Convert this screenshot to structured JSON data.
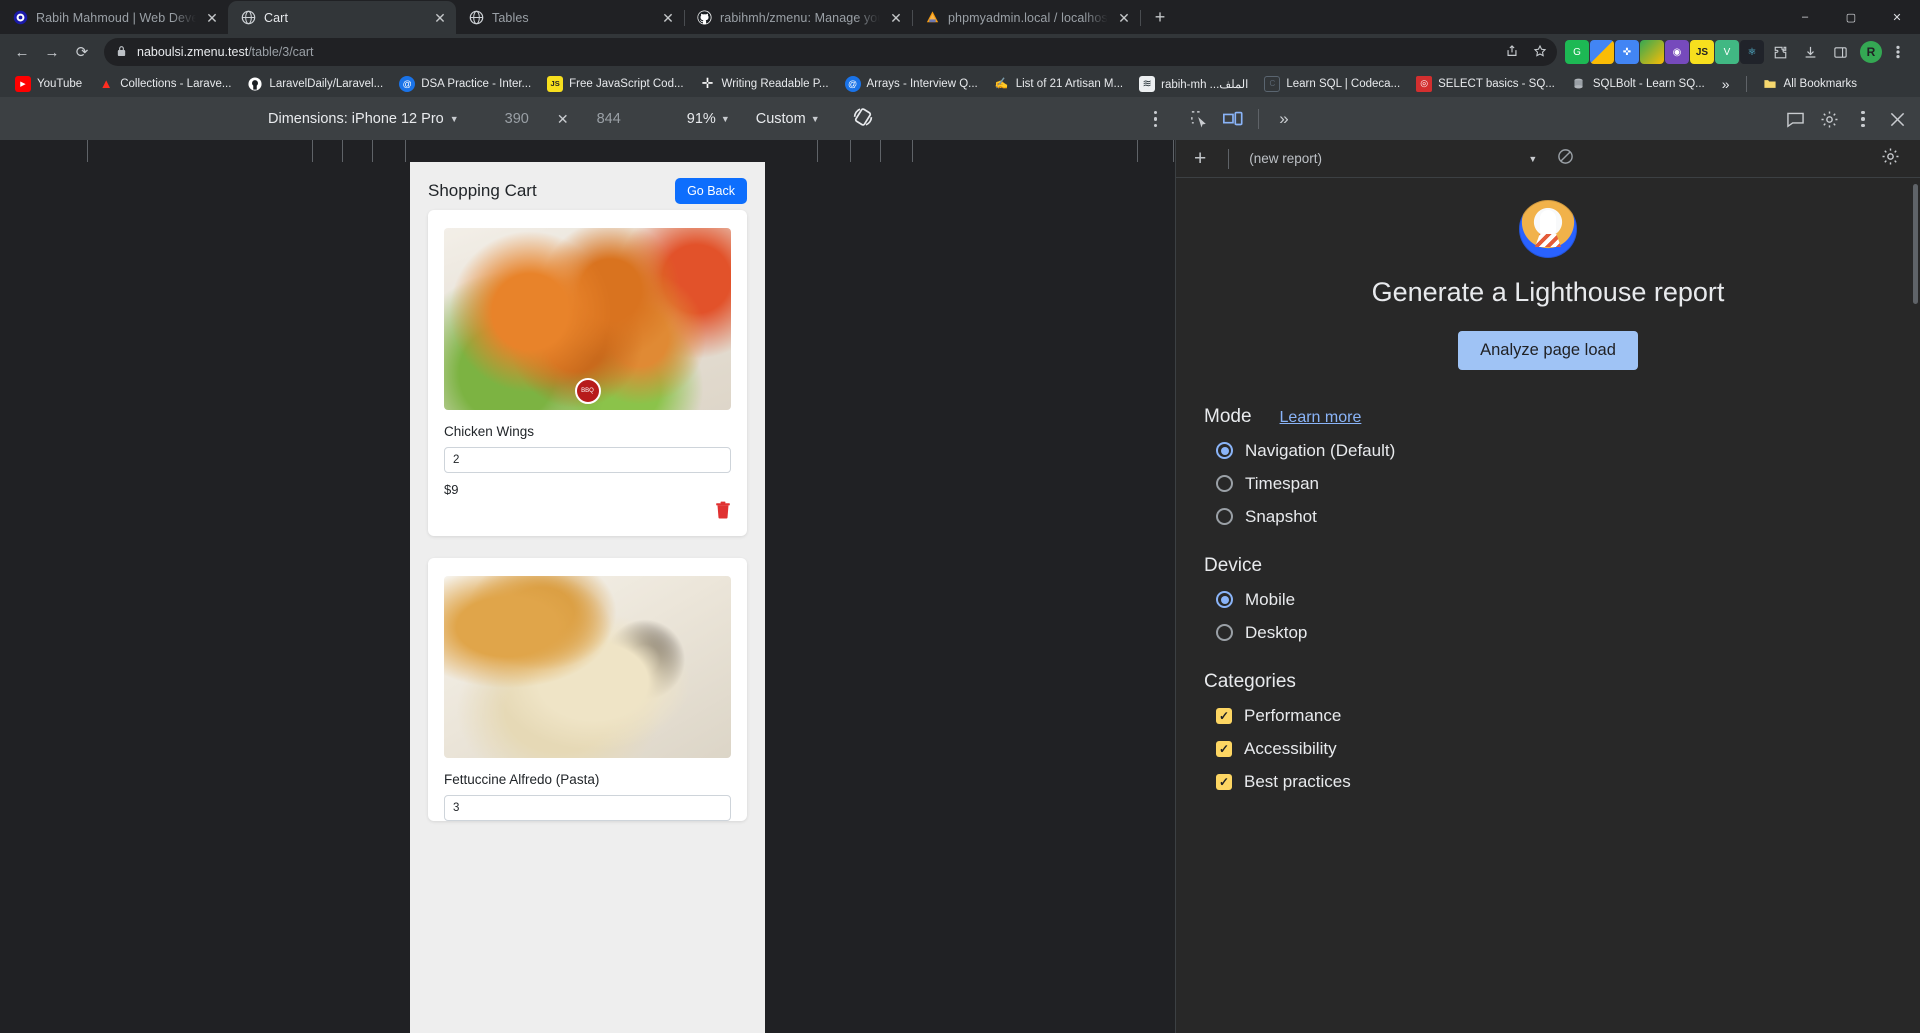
{
  "window": {
    "minimize": "–",
    "maximize": "▢",
    "close": "✕"
  },
  "tabs": [
    {
      "title": "Rabih Mahmoud | Web Develop",
      "favicon": "circle-logo-icon",
      "active": false,
      "close": "✕"
    },
    {
      "title": "Cart",
      "favicon": "globe-icon",
      "active": true,
      "close": "✕"
    },
    {
      "title": "Tables",
      "favicon": "globe-icon",
      "active": false,
      "close": "✕"
    },
    {
      "title": "rabihmh/zmenu: Manage your re",
      "favicon": "github-icon",
      "active": false,
      "close": "✕"
    },
    {
      "title": "phpmyadmin.local / localhost / ",
      "favicon": "phpmyadmin-icon",
      "active": false,
      "close": "✕"
    }
  ],
  "newtab_label": "+",
  "toolbar": {
    "back": "←",
    "forward": "→",
    "reload": "⟳",
    "lock_icon": "lock-icon",
    "url_domain": "naboulsi.zmenu.test",
    "url_path": "/table/3/cart",
    "share_icon": "share-icon",
    "star_icon": "star-icon",
    "extensions": [
      {
        "name": "grammarly-extension",
        "glyph": "G",
        "color": "#1db954"
      },
      {
        "name": "colorpicker-extension",
        "glyph": "◧",
        "color": "#4285f4"
      },
      {
        "name": "wappalyzer-extension",
        "glyph": "✜",
        "color": "#4285f4"
      },
      {
        "name": "imagecolor-extension",
        "glyph": "▣",
        "color": "#2b8a3e"
      },
      {
        "name": "redux-extension",
        "glyph": "◉",
        "color": "#764abc"
      },
      {
        "name": "json-extension",
        "glyph": "JS",
        "color": "#f7df1e"
      },
      {
        "name": "vue-devtools-extension",
        "glyph": "V",
        "color": "#41b883"
      },
      {
        "name": "react-devtools-extension",
        "glyph": "⚛",
        "color": "#61dafb"
      }
    ],
    "puzzle_icon": "puzzle-icon",
    "download_icon": "download-icon",
    "sidepanel_icon": "side-panel-icon",
    "profile_initial": "R",
    "menu_icon": "kebab-menu-icon"
  },
  "bookmarks": {
    "items": [
      {
        "label": "YouTube",
        "icon": "youtube-icon",
        "color": "#ff0000",
        "glyph": "▶"
      },
      {
        "label": "Collections - Larave...",
        "icon": "laravel-icon",
        "color": "#ff2d20",
        "glyph": "▲"
      },
      {
        "label": "LaravelDaily/Laravel...",
        "icon": "github-icon",
        "color": "#ffffff",
        "glyph": "◉"
      },
      {
        "label": "DSA Practice - Inter...",
        "icon": "notion-at-icon",
        "color": "#1a73e8",
        "glyph": "@"
      },
      {
        "label": "Free JavaScript Cod...",
        "icon": "javascript-icon",
        "color": "#f7df1e",
        "glyph": "JS"
      },
      {
        "label": "Writing Readable P...",
        "icon": "medium-plus-icon",
        "color": "#ffffff",
        "glyph": "✛"
      },
      {
        "label": "Arrays - Interview Q...",
        "icon": "notion-at-icon",
        "color": "#1a73e8",
        "glyph": "@"
      },
      {
        "label": "List of 21 Artisan M...",
        "icon": "laravel-news-icon",
        "color": "#c4c8cc",
        "glyph": "✍"
      },
      {
        "label": "rabih-mh ...الملف",
        "icon": "site-icon",
        "color": "#eceff1",
        "glyph": "≋"
      },
      {
        "label": "Learn SQL | Codeca...",
        "icon": "codecademy-icon",
        "color": "#5a6570",
        "glyph": "C"
      },
      {
        "label": "SELECT basics - SQ...",
        "icon": "sqlzoo-icon",
        "color": "#d32f2f",
        "glyph": "◎"
      },
      {
        "label": "SQLBolt - Learn SQ...",
        "icon": "sqlbolt-icon",
        "color": "#9aa0a6",
        "glyph": "🗄"
      }
    ],
    "overflow": "»",
    "all_bookmarks": "All Bookmarks",
    "all_bookmarks_icon": "folder-icon"
  },
  "device_toolbar": {
    "dimensions_label": "Dimensions: iPhone 12 Pro",
    "dimensions_caret": "▼",
    "width": "390",
    "times": "✕",
    "height": "844",
    "zoom": "91%",
    "zoom_caret": "▼",
    "throttling": "Custom",
    "throttling_caret": "▼",
    "rotate_icon": "rotate-device-icon",
    "more_icon": "kebab-menu-icon"
  },
  "page": {
    "title": "Shopping Cart",
    "go_back": "Go Back",
    "items": [
      {
        "name": "Chicken Wings",
        "quantity": "2",
        "price": "$9",
        "image": "fried-chicken-wings-photo",
        "delete_icon": "trash-icon"
      },
      {
        "name": "Fettuccine Alfredo (Pasta)",
        "quantity": "3",
        "price": "",
        "image": "fettuccine-alfredo-photo",
        "delete_icon": "trash-icon"
      }
    ]
  },
  "devtools": {
    "inspect_icon": "inspect-element-icon",
    "device_toggle_icon": "device-toolbar-icon",
    "more_tabs": "»",
    "issues_icon": "issues-message-icon",
    "settings_icon": "gear-icon",
    "menu_icon": "kebab-menu-icon",
    "close_icon": "close-icon"
  },
  "lighthouse": {
    "add_icon": "+",
    "report_select": "(new report)",
    "select_caret": "▼",
    "clear_icon": "clear-report-icon",
    "settings_icon": "gear-icon",
    "logo": "lighthouse-logo-icon",
    "heading": "Generate a Lighthouse report",
    "analyze_button": "Analyze page load",
    "mode": {
      "title": "Mode",
      "learn_more": "Learn more",
      "options": [
        {
          "label": "Navigation (Default)",
          "selected": true
        },
        {
          "label": "Timespan",
          "selected": false
        },
        {
          "label": "Snapshot",
          "selected": false
        }
      ]
    },
    "device": {
      "title": "Device",
      "options": [
        {
          "label": "Mobile",
          "selected": true
        },
        {
          "label": "Desktop",
          "selected": false
        }
      ]
    },
    "categories": {
      "title": "Categories",
      "options": [
        {
          "label": "Performance",
          "checked": true
        },
        {
          "label": "Accessibility",
          "checked": true
        },
        {
          "label": "Best practices",
          "checked": true
        }
      ]
    }
  },
  "colors": {
    "accent_blue": "#8ab4f8",
    "button_blue": "#0d6efd",
    "checkbox_yellow": "#fdd663",
    "trash_red": "#e03131"
  }
}
